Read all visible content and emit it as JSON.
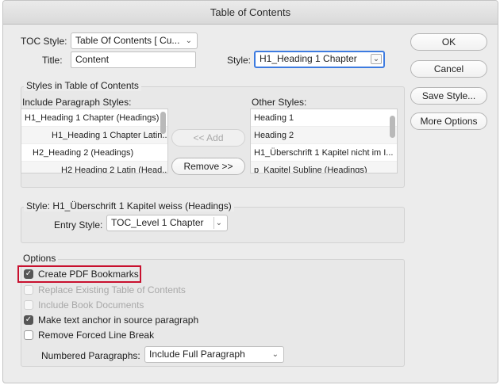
{
  "window": {
    "title": "Table of Contents"
  },
  "toc_style": {
    "label": "TOC Style:",
    "value": "Table Of Contents [ Cu..."
  },
  "title_field": {
    "label": "Title:",
    "value": "Content"
  },
  "style_field": {
    "label": "Style:",
    "value": "H1_Heading 1 Chapter"
  },
  "styles_group": {
    "legend": "Styles in Table of Contents",
    "include_label": "Include Paragraph Styles:",
    "other_label": "Other Styles:",
    "include_items": [
      "H1_Heading 1 Chapter (Headings)",
      "H1_Heading 1 Chapter Latin...",
      "H2_Heading 2 (Headings)",
      "H2 Heading 2 Latin (Head..."
    ],
    "other_items": [
      "Heading 1",
      "Heading 2",
      "H1_Überschrift 1 Kapitel nicht im I...",
      "p_Kapitel Subline (Headings)"
    ],
    "add_button": "<< Add",
    "remove_button": "Remove >>"
  },
  "style_group": {
    "legend": "Style: H1_Überschrift 1 Kapitel weiss (Headings)",
    "entry_style_label": "Entry Style:",
    "entry_style_value": "TOC_Level 1 Chapter"
  },
  "options": {
    "legend": "Options",
    "create_pdf_bookmarks": {
      "label": "Create PDF Bookmarks",
      "checked": true,
      "enabled": true
    },
    "replace_existing": {
      "label": "Replace Existing Table of Contents",
      "checked": false,
      "enabled": false
    },
    "include_book": {
      "label": "Include Book Documents",
      "checked": false,
      "enabled": false
    },
    "make_anchor": {
      "label": "Make text anchor in source paragraph",
      "checked": true,
      "enabled": true
    },
    "remove_forced": {
      "label": "Remove Forced Line Break",
      "checked": false,
      "enabled": true
    },
    "numbered_label": "Numbered Paragraphs:",
    "numbered_value": "Include Full Paragraph"
  },
  "buttons": {
    "ok": "OK",
    "cancel": "Cancel",
    "save_style": "Save Style...",
    "more_options": "More Options"
  },
  "colors": {
    "highlight": "#c8102e",
    "focus": "#3d7be0"
  }
}
